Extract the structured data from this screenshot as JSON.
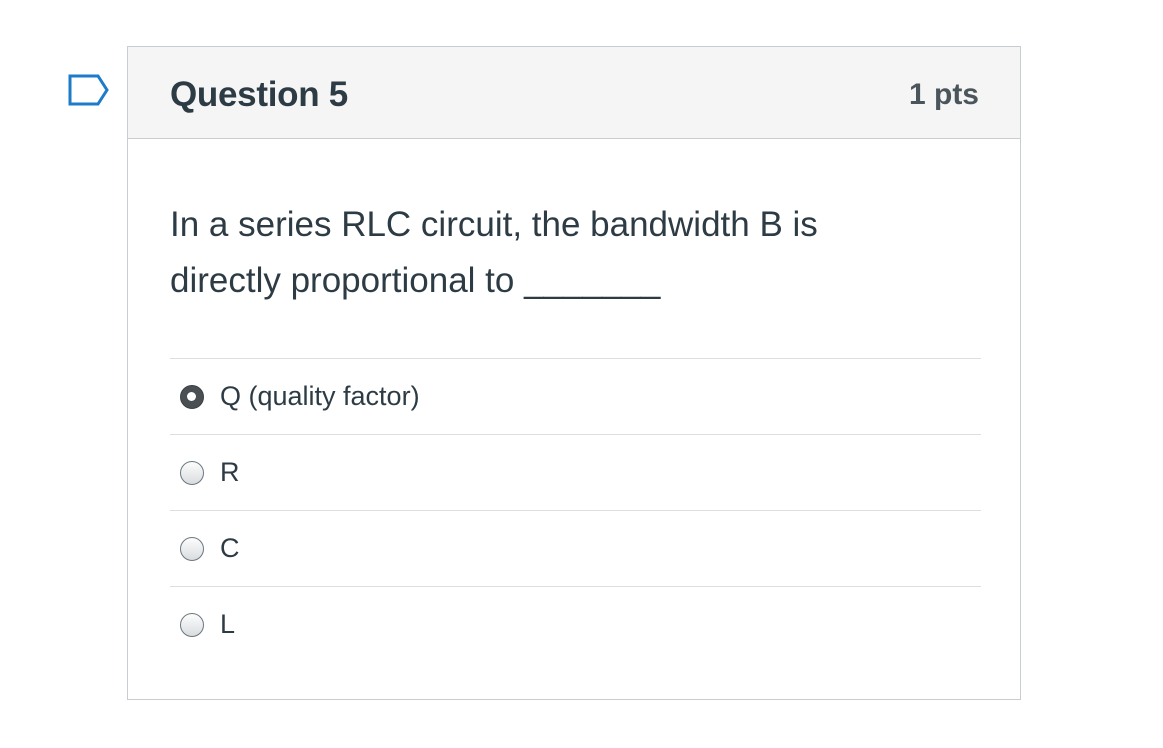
{
  "question": {
    "title": "Question 5",
    "points": "1 pts",
    "text": "In a series RLC circuit, the bandwidth B is directly proportional to _______"
  },
  "answers": [
    {
      "label": "Q (quality factor)",
      "selected": true
    },
    {
      "label": "R",
      "selected": false
    },
    {
      "label": "C",
      "selected": false
    },
    {
      "label": "L",
      "selected": false
    }
  ],
  "icons": {
    "flag": "flag-question-icon"
  },
  "colors": {
    "text": "#2d3b45",
    "flag": "#1e7bc9",
    "header_bg": "#f5f5f5",
    "border": "#c7cdd1"
  }
}
